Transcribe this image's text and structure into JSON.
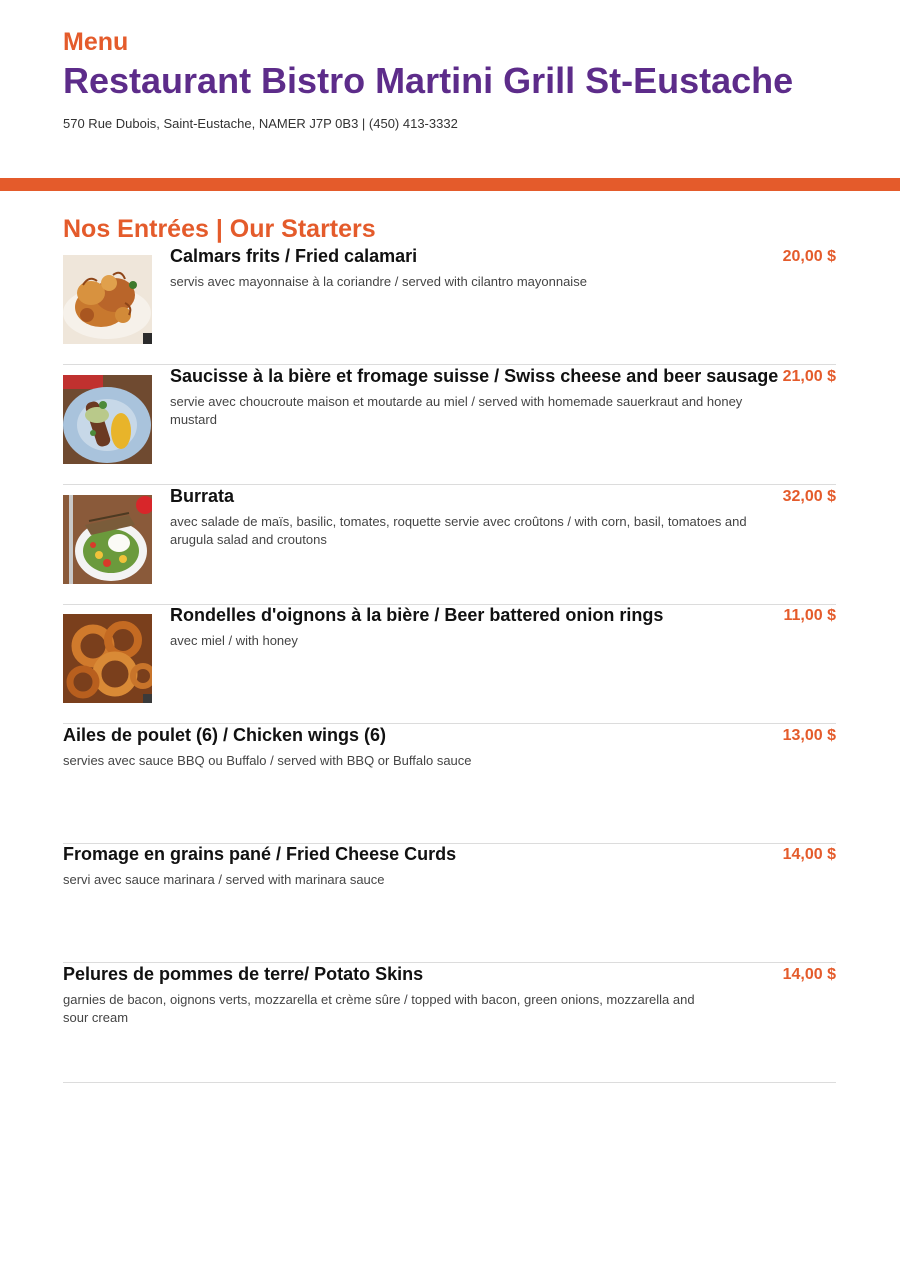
{
  "header": {
    "kicker": "Menu",
    "title": "Restaurant Bistro Martini Grill St-Eustache",
    "address": "570 Rue Dubois, Saint-Eustache, NAMER J7P 0B3 | (450) 413-3332"
  },
  "section": {
    "title": "Nos Entrées | Our Starters"
  },
  "items": [
    {
      "name": "Calmars frits / Fried calamari",
      "desc": "servis avec mayonnaise à la coriandre / served with cilantro mayonnaise",
      "price": "20,00 $",
      "photo": "fried-calamari-photo"
    },
    {
      "name": "Saucisse à la bière et fromage suisse / Swiss cheese and beer sausage",
      "desc": "servie avec choucroute maison et moutarde au miel / served with homemade sauerkraut and honey mustard",
      "price": "21,00 $",
      "photo": "sausage-plate-photo"
    },
    {
      "name": "Burrata",
      "desc": "avec salade de maïs, basilic, tomates, roquette servie avec croûtons / with corn, basil, tomatoes and arugula salad and croutons",
      "price": "32,00 $",
      "photo": "burrata-salad-photo"
    },
    {
      "name": "Rondelles d'oignons à la bière / Beer battered onion rings",
      "desc": "avec miel / with honey",
      "price": "11,00 $",
      "photo": "onion-rings-photo"
    },
    {
      "name": "Ailes de poulet (6) / Chicken wings (6)",
      "desc": "servies avec sauce BBQ ou Buffalo / served with BBQ or Buffalo sauce",
      "price": "13,00 $"
    },
    {
      "name": "Fromage en grains pané / Fried Cheese Curds",
      "desc": "servi avec sauce marinara / served with marinara sauce",
      "price": "14,00 $"
    },
    {
      "name": "Pelures de pommes de terre/ Potato Skins",
      "desc": "garnies de bacon, oignons verts, mozzarella et crème sûre / topped with bacon, green onions, mozzarella and sour cream",
      "price": "14,00 $"
    }
  ]
}
